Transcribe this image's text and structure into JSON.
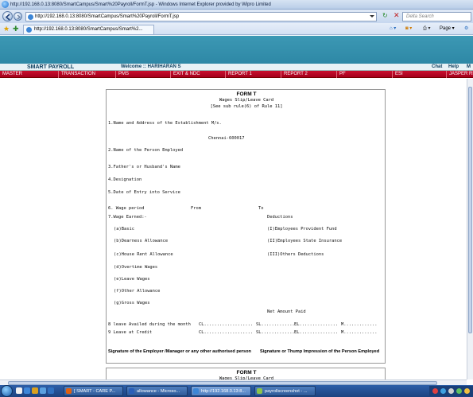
{
  "window": {
    "title": "http://192.168.0.13:8080/SmartCampus/Smart%20Payroll/FormT.jsp - Windows Internet Explorer provided by Wipro Limited"
  },
  "address_bar": {
    "url": "http://192.168.0.13:8080/SmartCampus/Smart%20Payroll/FormT.jsp",
    "search_placeholder": "Delta Search"
  },
  "tab_bar": {
    "tab_label": "http://192.168.0.13:8080/SmartCampus/Smart%2...",
    "page_label": "Page ▾"
  },
  "app": {
    "title": "SMART PAYROLL",
    "welcome": "Welcome :: HARIHARAN S",
    "links": [
      "Chat",
      "Help",
      "M"
    ]
  },
  "menu": {
    "items": [
      "MASTER",
      "TRANSACTION",
      "PMS",
      "EXIT & NDC",
      "REPORT 1",
      "REPORT 2",
      "PF",
      "ESI",
      "JASPER RE"
    ]
  },
  "form": {
    "title": "FORM T",
    "subtitle": "Wages Slip/Leave Card",
    "rule": "[See sub rule(6) of Rule 11]",
    "establishment_label": "1.Name and Address of the Establishment M/s.",
    "city": "Chennai-600017",
    "employee_label": "2.Name of the Person Employed",
    "father_label": "3.Father's or Husband's Name",
    "designation_label": "4.Designation",
    "doj_label": "5.Date of Entry into Service",
    "wage_period_label": "6. Wage period",
    "from_label": "From",
    "to_label": "To",
    "wage_earned_label": "7.Wage Earned:-",
    "deductions_label": "Deductions",
    "earnings": [
      "(a)Basic",
      "(b)Dearness Allowance",
      "(c)House Rent Allowance",
      "(d)Overtime Wages",
      "(e)Leave Wages",
      "(f)Other Allowance",
      "(g)Gross Wages"
    ],
    "deductions": [
      "(I)Employees Provident Fund",
      "(II)Employees State Insurance",
      "(III)Others Deductions"
    ],
    "net_amount_label": "Net Amount Paid",
    "leave_availed_label": "8 leave Availed during the month",
    "leave_credit_label": "9 Leave at Credit",
    "leave_codes_availed": [
      "CL...................",
      "SL..............",
      "EL...............",
      "M............."
    ],
    "leave_codes_credit": [
      "CL...................",
      "SL..............",
      "EL...............",
      "M............."
    ],
    "signature_employer": "Signature of the Employer /Manager or any other authorised person",
    "signature_employee": "Signature or Thump Impression of the Person Employed"
  },
  "form2": {
    "title": "FORM T",
    "subtitle": "Wages Slip/Leave Card"
  },
  "taskbar": {
    "buttons": [
      "[ SMART - CARE P...",
      "allowance - Microso...",
      "http://192.168.0.13:8...",
      "payrollscreenshot - ..."
    ],
    "active_index": 2
  },
  "colors": {
    "banner": "#3392b0",
    "menu_bar": "#b8082a",
    "taskbar": "#24508f"
  }
}
